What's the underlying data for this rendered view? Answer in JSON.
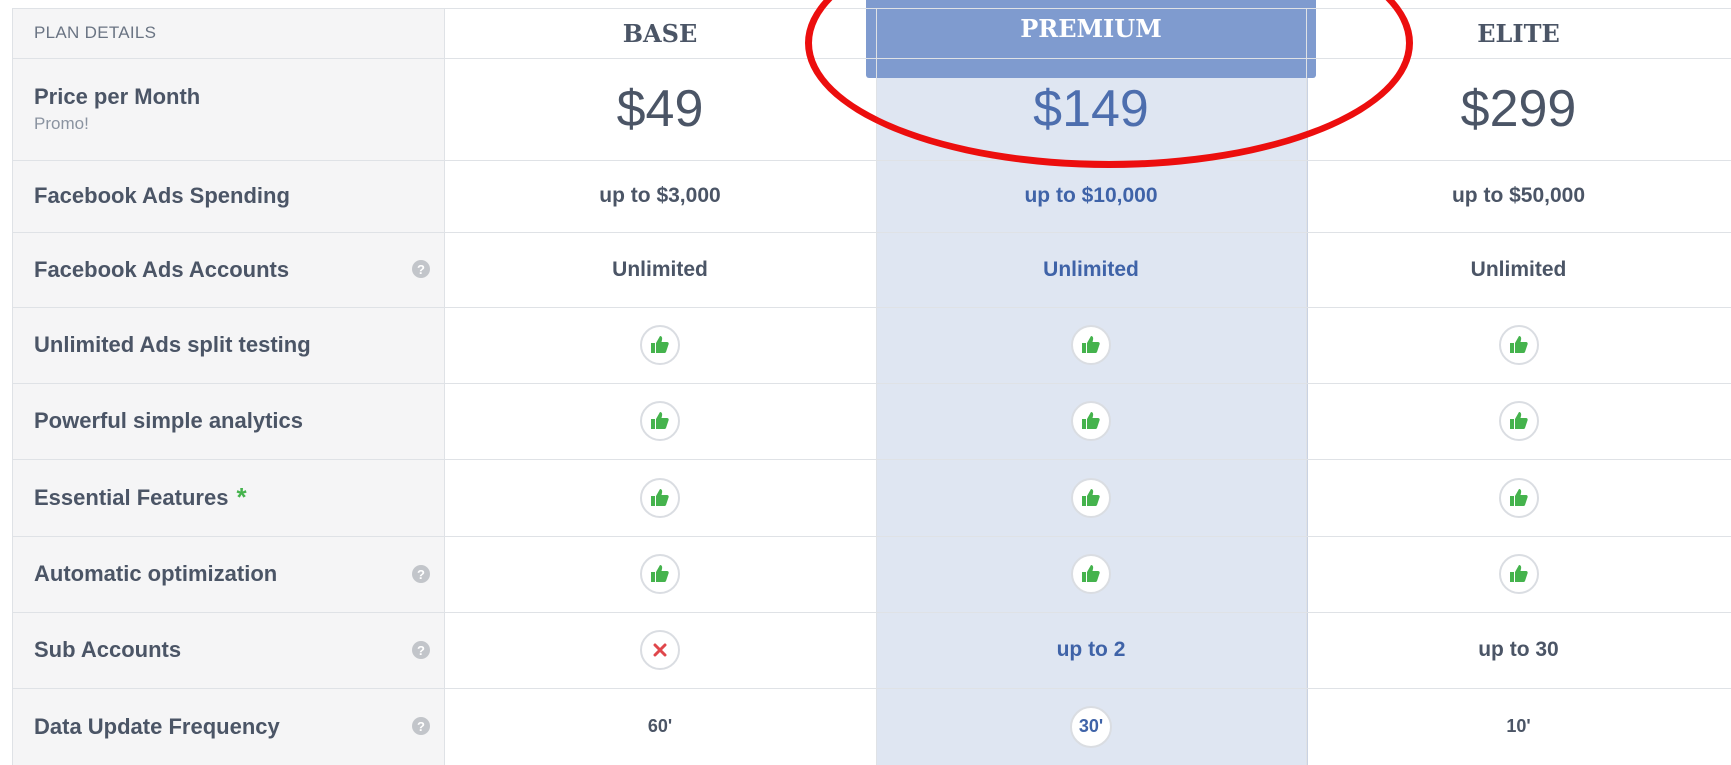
{
  "header": {
    "plan_details_label": "PLAN DETAILS",
    "plans": [
      "BASE",
      "PREMIUM",
      "ELITE"
    ]
  },
  "price_row": {
    "label": "Price per Month",
    "sublabel": "Promo!",
    "values": [
      "$49",
      "$149",
      "$299"
    ]
  },
  "rows": [
    {
      "label": "Facebook Ads Spending",
      "help": false,
      "values": [
        "up to $3,000",
        "up to $10,000",
        "up to $50,000"
      ]
    },
    {
      "label": "Facebook Ads Accounts",
      "help": true,
      "values": [
        "Unlimited",
        "Unlimited",
        "Unlimited"
      ]
    },
    {
      "label": "Unlimited Ads split testing",
      "help": false,
      "values": [
        "thumbs-up-icon",
        "thumbs-up-icon",
        "thumbs-up-icon"
      ]
    },
    {
      "label": "Powerful simple analytics",
      "help": false,
      "values": [
        "thumbs-up-icon",
        "thumbs-up-icon",
        "thumbs-up-icon"
      ]
    },
    {
      "label": "Essential Features",
      "asterisk": "*",
      "help": false,
      "values": [
        "thumbs-up-icon",
        "thumbs-up-icon",
        "thumbs-up-icon"
      ]
    },
    {
      "label": "Automatic optimization",
      "help": true,
      "values": [
        "thumbs-up-icon",
        "thumbs-up-icon",
        "thumbs-up-icon"
      ]
    },
    {
      "label": "Sub Accounts",
      "help": true,
      "values": [
        "cross-icon",
        "up to 2",
        "up to 30"
      ]
    },
    {
      "label": "Data Update Frequency",
      "help": true,
      "values": [
        "60'",
        "30'",
        "10'"
      ]
    }
  ],
  "help_glyph": "?",
  "colors": {
    "premium_header": "#7f9bcf",
    "premium_column": "#dfe6f2",
    "premium_text": "#3f63a8",
    "thumbs_up_green": "#45b34d",
    "cross_red": "#e0474c",
    "annotation_red": "#ec0e0e"
  }
}
